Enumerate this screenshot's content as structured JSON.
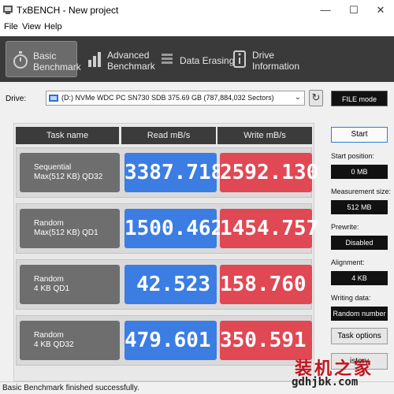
{
  "window": {
    "title": "TxBENCH - New project"
  },
  "menu": [
    "File",
    "View",
    "Help"
  ],
  "tabs": [
    {
      "label": "Basic\nBenchmark",
      "icon": "stopwatch-icon",
      "active": true
    },
    {
      "label": "Advanced\nBenchmark",
      "icon": "bar-chart-icon",
      "active": false
    },
    {
      "label": "Data Erasing",
      "icon": "eraser-icon",
      "active": false
    },
    {
      "label": "Drive\nInformation",
      "icon": "drive-info-icon",
      "active": false
    }
  ],
  "drive": {
    "label": "Drive:",
    "selected": "(D:) NVMe WDC PC SN730 SDB  375.69 GB (787,884,032 Sectors)",
    "file_mode_label": "FILE mode"
  },
  "results": {
    "headers": {
      "task": "Task name",
      "read": "Read mB/s",
      "write": "Write mB/s"
    },
    "rows": [
      {
        "name": "Sequential\nMax(512 KB) QD32",
        "read": "3387.718",
        "write": "2592.130"
      },
      {
        "name": "Random\nMax(512 KB) QD1",
        "read": "1500.462",
        "write": "1454.757"
      },
      {
        "name": "Random\n4 KB QD1",
        "read": "42.523",
        "write": "158.760"
      },
      {
        "name": "Random\n4 KB QD32",
        "read": "479.601",
        "write": "350.591"
      }
    ]
  },
  "side": {
    "start_label": "Start",
    "start_position_label": "Start position:",
    "start_position_value": "0 MB",
    "measurement_size_label": "Measurement size:",
    "measurement_size_value": "512 MB",
    "prewrite_label": "Prewrite:",
    "prewrite_value": "Disabled",
    "alignment_label": "Alignment:",
    "alignment_value": "4 KB",
    "writing_data_label": "Writing data:",
    "writing_data_value": "Random number",
    "task_options_label": "Task options",
    "history_label": "istory"
  },
  "status": "Basic Benchmark finished successfully.",
  "watermark": {
    "cn": "装机之家",
    "url": "gdhjbk.com"
  },
  "colors": {
    "read": "#3b7de3",
    "write": "#e04854",
    "tabbar": "#3a3a3a",
    "accent_red": "#c0151d"
  }
}
